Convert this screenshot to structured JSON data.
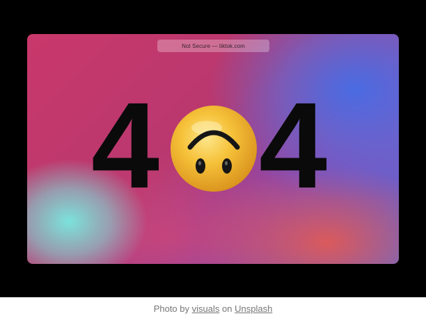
{
  "browser": {
    "address_text": "Not Secure — tiktok.com"
  },
  "error_page": {
    "digit_left": "4",
    "digit_right": "4",
    "emoji_icon": "upside-down-face-icon"
  },
  "caption": {
    "prefix": "Photo by",
    "author": "visuals",
    "middle": "on",
    "site": "Unsplash"
  },
  "colors": {
    "frame_background": "#000000",
    "digit_color": "#0a0a0a",
    "emoji_yellow": "#f6c23a",
    "caption_text": "#767676"
  }
}
